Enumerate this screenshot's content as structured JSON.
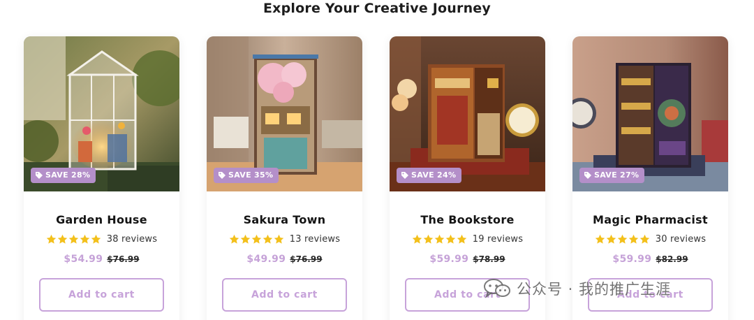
{
  "section": {
    "title": "Explore Your Creative Journey"
  },
  "colors": {
    "accent": "#c7a3da",
    "badge": "#b48fc9",
    "star": "#f3c01b"
  },
  "products": [
    {
      "name": "Garden House",
      "badge": "SAVE 28%",
      "rating": 5,
      "reviews": "38 reviews",
      "price": "$54.99",
      "compare_price": "$76.99",
      "button": "Add to cart"
    },
    {
      "name": "Sakura Town",
      "badge": "SAVE 35%",
      "rating": 5,
      "reviews": "13 reviews",
      "price": "$49.99",
      "compare_price": "$76.99",
      "button": "Add to cart"
    },
    {
      "name": "The Bookstore",
      "badge": "SAVE 24%",
      "rating": 5,
      "reviews": "19 reviews",
      "price": "$59.99",
      "compare_price": "$78.99",
      "button": "Add to cart"
    },
    {
      "name": "Magic Pharmacist",
      "badge": "SAVE 27%",
      "rating": 5,
      "reviews": "30 reviews",
      "price": "$59.99",
      "compare_price": "$82.99",
      "button": "Add to cart"
    }
  ],
  "watermark": {
    "text": "公众号 · 我的推广生涯",
    "icon": "wechat-icon"
  }
}
